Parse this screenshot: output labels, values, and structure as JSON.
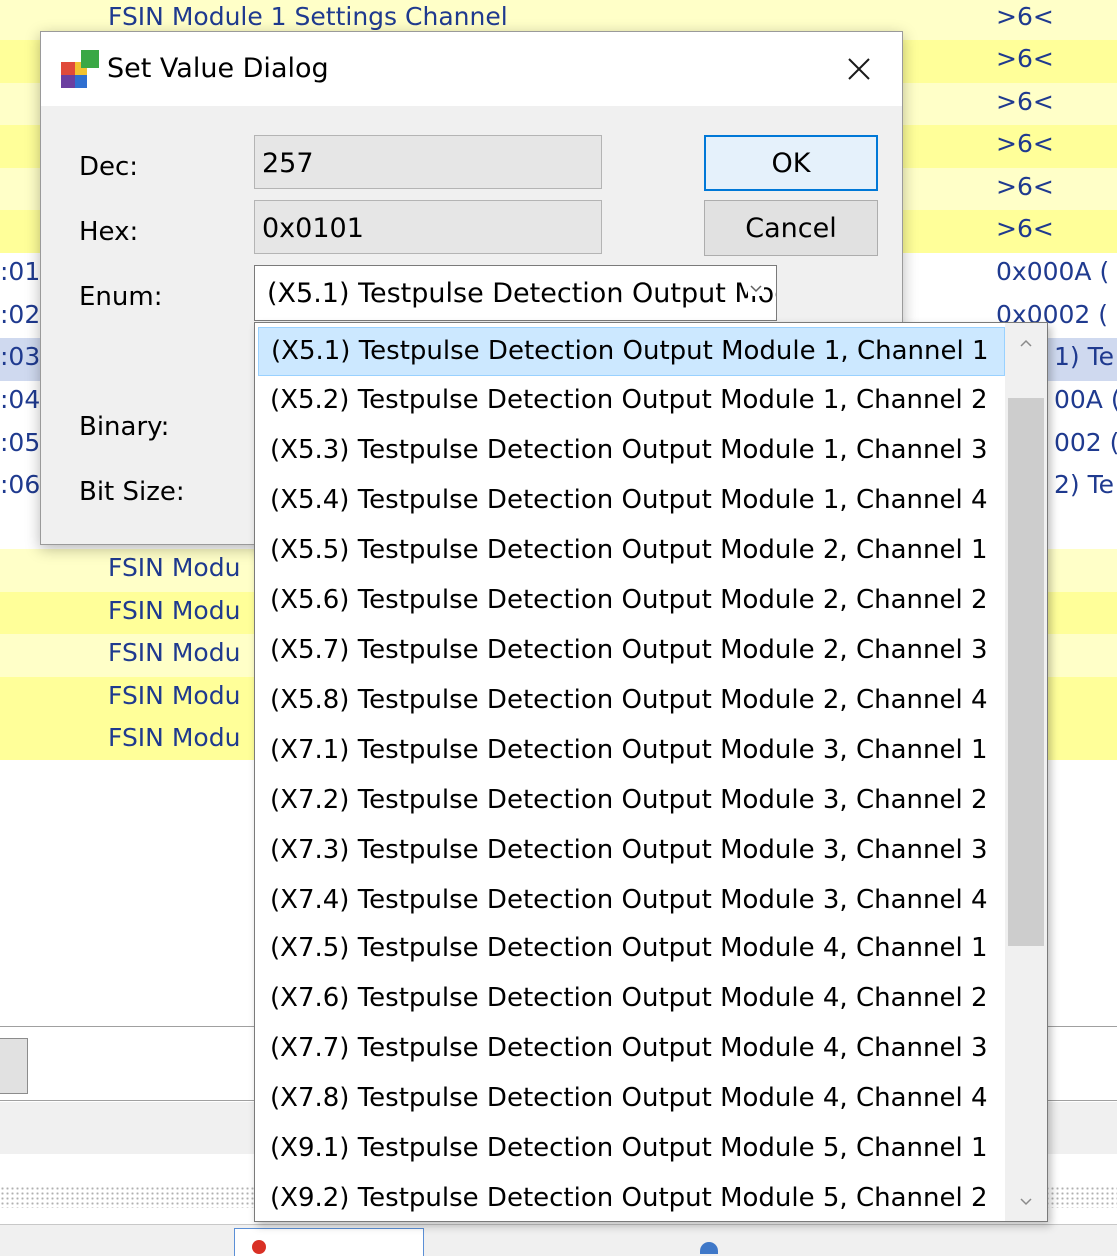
{
  "background": {
    "module_label": "FSIN Module",
    "top_row_text": "FSIN Module   1 Settings Channel",
    "right_values": [
      ">6<",
      ">6<",
      ">6<",
      ">6<",
      ">6<",
      ">6<",
      "0x000A (",
      "0x0002 (",
      "1) Te",
      "00A (",
      "002 (",
      "2) Te"
    ],
    "index_labels": [
      ":01",
      ":02",
      ":03",
      ":04",
      ":05",
      ":06"
    ],
    "module_rows": [
      "FSIN Modu",
      "FSIN Modu",
      "FSIN Modu",
      "FSIN Modu",
      "FSIN Modu"
    ]
  },
  "dialog": {
    "title": "Set Value Dialog",
    "close_glyph": "×",
    "labels": {
      "dec": "Dec:",
      "hex": "Hex:",
      "enum": "Enum:",
      "binary": "Binary:",
      "bit_size": "Bit Size:"
    },
    "dec_value": "257",
    "hex_value": "0x0101",
    "enum_selected": "(X5.1) Testpulse Detection Output Module 1, Channel 1",
    "ok_label": "OK",
    "cancel_label": "Cancel"
  },
  "dropdown": {
    "items": [
      "(X5.1) Testpulse Detection Output Module 1, Channel 1",
      "(X5.2) Testpulse Detection Output Module 1, Channel 2",
      "(X5.3) Testpulse Detection Output Module 1, Channel 3",
      "(X5.4) Testpulse Detection Output Module 1, Channel 4",
      "(X5.5) Testpulse Detection Output Module 2, Channel 1",
      "(X5.6) Testpulse Detection Output Module 2, Channel 2",
      "(X5.7) Testpulse Detection Output Module 2, Channel 3",
      "(X5.8) Testpulse Detection Output Module 2, Channel 4",
      "(X7.1) Testpulse Detection Output Module 3, Channel 1",
      "(X7.2) Testpulse Detection Output Module 3, Channel 2",
      "(X7.3) Testpulse Detection Output Module 3, Channel 3",
      "(X7.4) Testpulse Detection Output Module 3, Channel 4",
      "(X7.5) Testpulse Detection Output Module 4, Channel 1",
      "(X7.6) Testpulse Detection Output Module 4, Channel 2",
      "(X7.7) Testpulse Detection Output Module 4, Channel 3",
      "(X7.8) Testpulse Detection Output Module 4, Channel 4",
      "(X9.1) Testpulse Detection Output Module 5, Channel 1",
      "(X9.2) Testpulse Detection Output Module 5, Channel 2"
    ],
    "selected_index": 0
  },
  "icons": {
    "app": "app-window-icon",
    "close": "close-icon",
    "combo": "chevron-down-icon",
    "scroll_up": "chevron-up-icon",
    "scroll_down": "chevron-down-icon"
  },
  "colors": {
    "row_light": "#ffffc8",
    "row_yellow": "#ffff99",
    "selection": "#cce8ff",
    "accent": "#0078d7"
  }
}
